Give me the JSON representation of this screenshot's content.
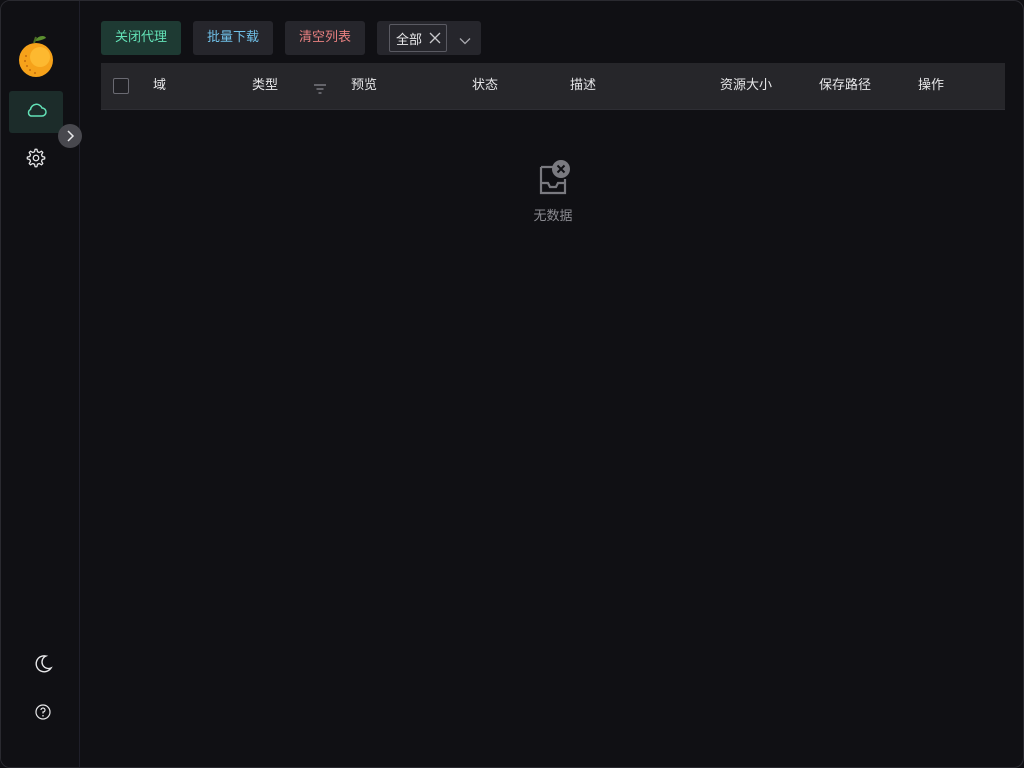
{
  "toolbar": {
    "close_proxy_label": "关闭代理",
    "batch_download_label": "批量下载",
    "clear_list_label": "清空列表",
    "type_filter": {
      "selected": "全部"
    }
  },
  "table": {
    "columns": [
      "域",
      "类型",
      "预览",
      "状态",
      "描述",
      "资源大小",
      "保存路径",
      "操作"
    ],
    "rows": []
  },
  "empty_state": {
    "text": "无数据"
  },
  "sidebar": {
    "items": [
      {
        "icon": "cloud-icon",
        "active": true
      },
      {
        "icon": "gear-icon",
        "active": false
      }
    ],
    "bottom": [
      {
        "icon": "moon-icon"
      },
      {
        "icon": "help-icon"
      }
    ]
  },
  "colors": {
    "accent_green": "#63e2b7",
    "accent_blue": "#70c0e8",
    "accent_red": "#e88080",
    "background": "#101014"
  }
}
